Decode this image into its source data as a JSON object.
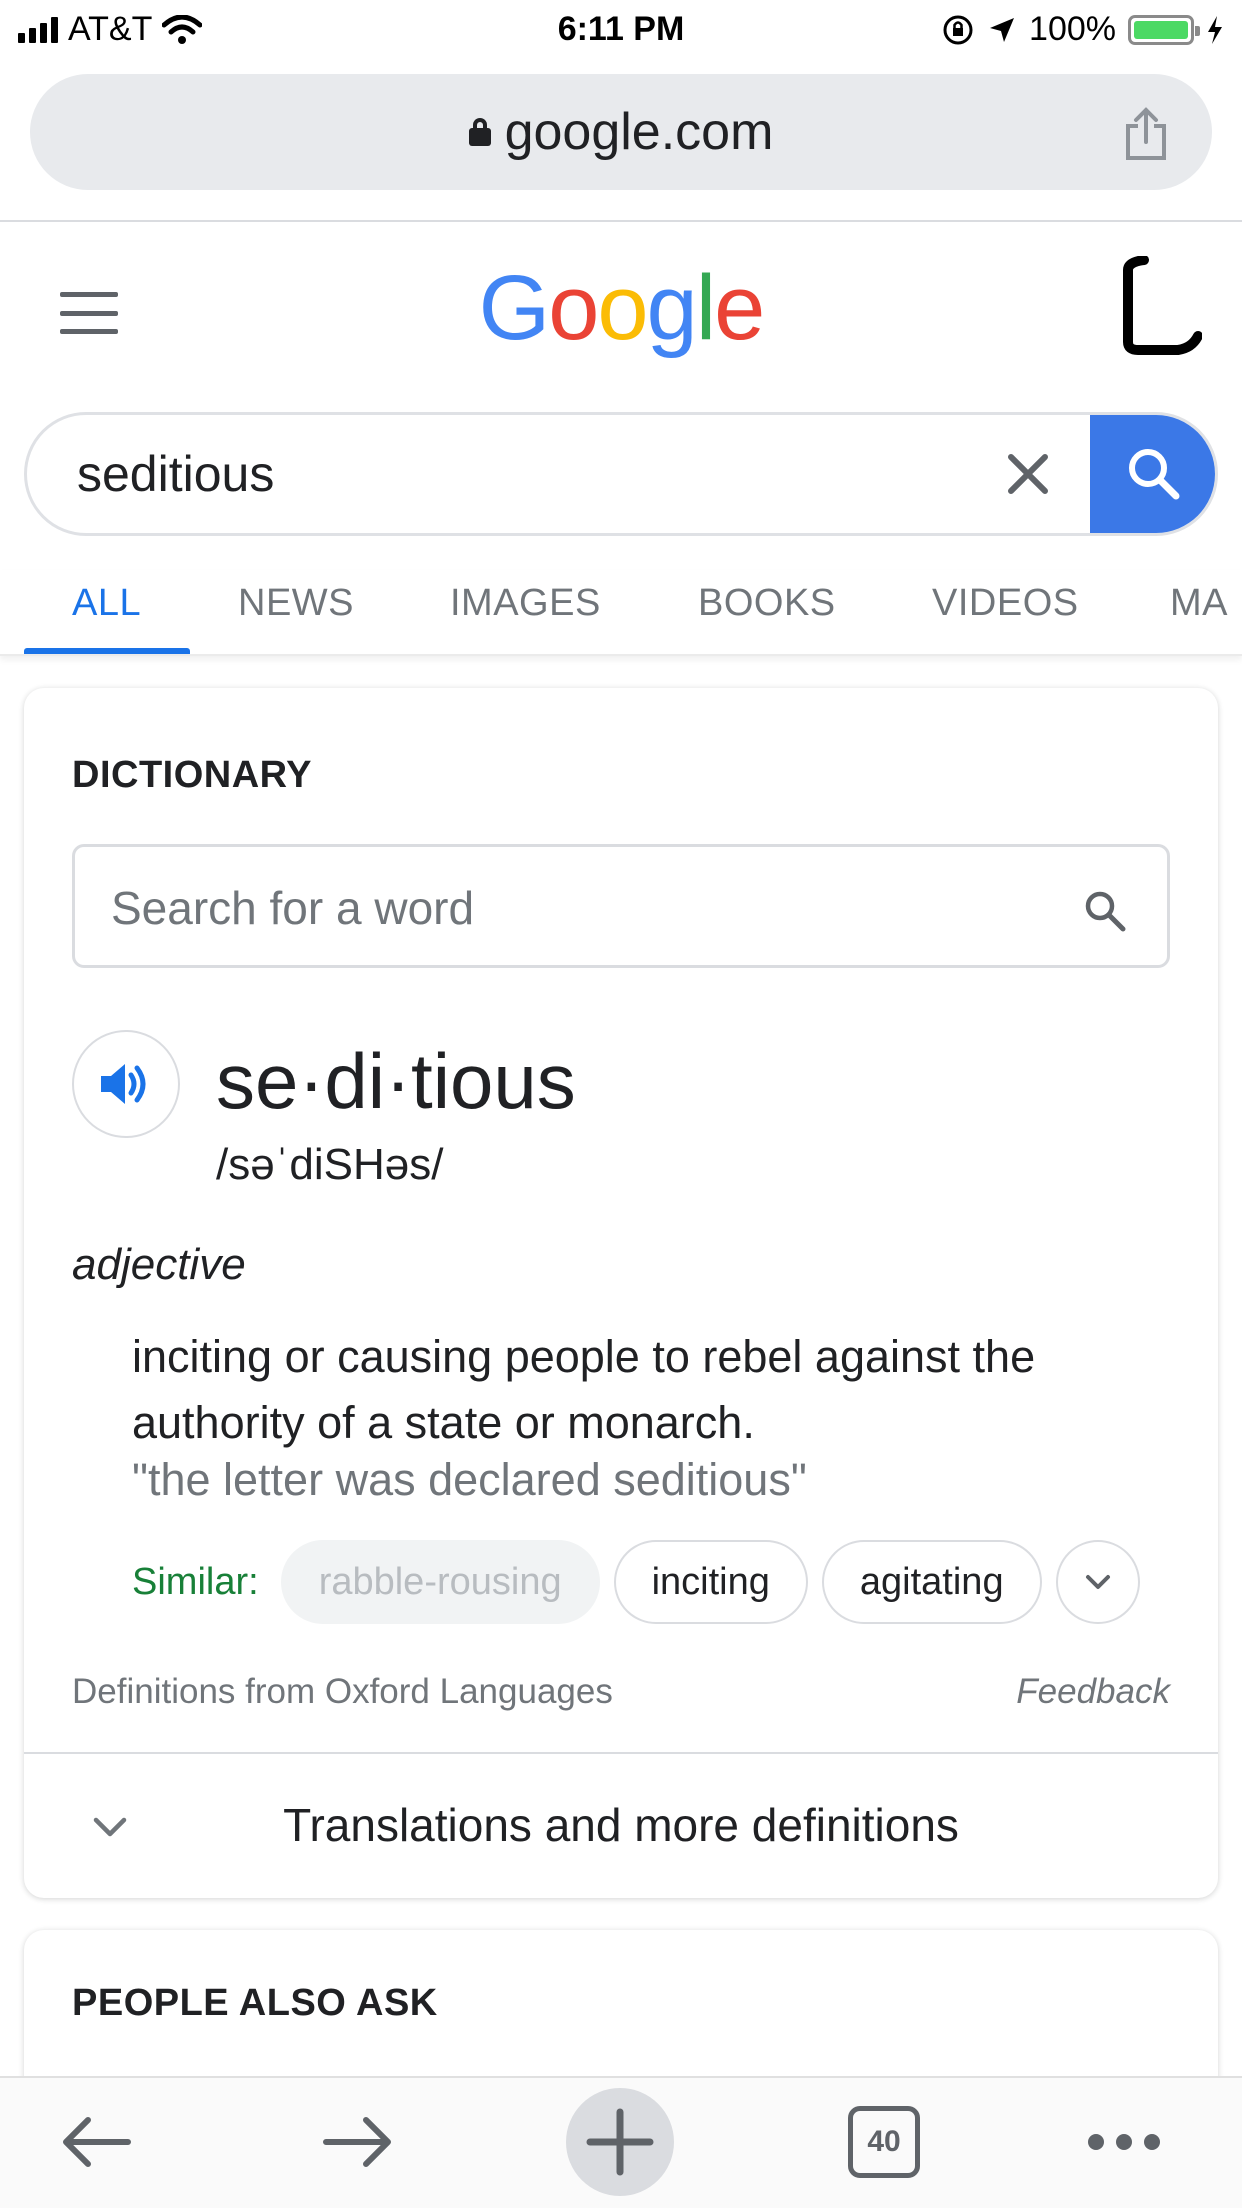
{
  "status_bar": {
    "carrier": "AT&T",
    "time": "6:11 PM",
    "battery_percent": "100%",
    "battery_level": 1.0,
    "battery_color": "#4cd964"
  },
  "browser": {
    "url": "google.com",
    "icons": [
      "lock-icon",
      "share-icon"
    ]
  },
  "header": {
    "logo_letters": [
      "G",
      "o",
      "o",
      "g",
      "l",
      "e"
    ],
    "logo_colors": [
      "#4285f4",
      "#ea4335",
      "#fbbc05",
      "#4285f4",
      "#34a853",
      "#ea4335"
    ],
    "icons": [
      "hamburger-menu-icon",
      "account-avatar"
    ]
  },
  "search": {
    "query": "seditious",
    "button_color": "#3b78e7",
    "icons": [
      "clear-icon",
      "search-icon"
    ]
  },
  "tabs": [
    {
      "label": "ALL",
      "active": true
    },
    {
      "label": "NEWS",
      "active": false
    },
    {
      "label": "IMAGES",
      "active": false
    },
    {
      "label": "BOOKS",
      "active": false
    },
    {
      "label": "VIDEOS",
      "active": false
    },
    {
      "label": "MA",
      "active": false
    }
  ],
  "dictionary": {
    "heading": "DICTIONARY",
    "search_placeholder": "Search for a word",
    "headword": "se·di·tious",
    "phonetic": "/səˈdiSHəs/",
    "part_of_speech": "adjective",
    "definition": "inciting or causing people to rebel against the authority of a state or monarch.",
    "example": "\"the letter was declared seditious\"",
    "similar_label": "Similar:",
    "similar": [
      "rabble-rousing",
      "inciting",
      "agitating"
    ],
    "source": "Definitions from Oxford Languages",
    "feedback": "Feedback",
    "more_label": "Translations and more definitions",
    "accent_color": "#1a73e8"
  },
  "people_also_ask": {
    "heading": "PEOPLE ALSO ASK"
  },
  "toolbar": {
    "tab_count": "40",
    "icons": [
      "back-arrow-icon",
      "forward-arrow-icon",
      "new-tab-plus-icon",
      "tab-switcher-icon",
      "more-menu-icon"
    ]
  }
}
